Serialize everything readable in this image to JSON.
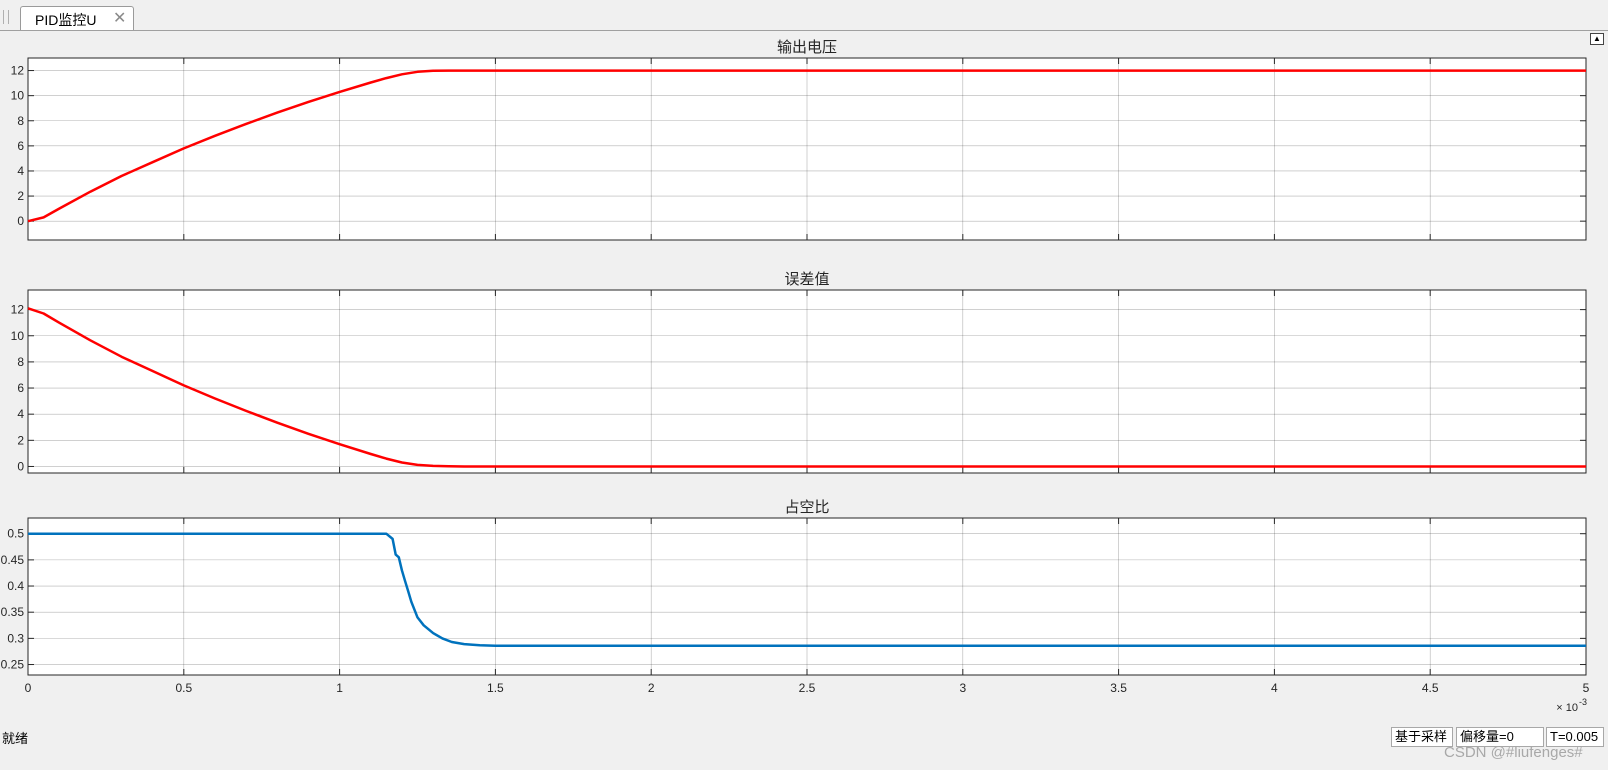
{
  "tab": {
    "label": "PID监控U",
    "close_glyph": "✕"
  },
  "status": {
    "ready": "就绪",
    "sampling": "基于采样",
    "offset": "偏移量=0",
    "time": "T=0.005"
  },
  "watermark": "CSDN @#liufenges#",
  "chart_data": [
    {
      "type": "line",
      "title": "输出电压",
      "xlim": [
        0,
        5
      ],
      "ylim": [
        -1.5,
        13
      ],
      "yticks": [
        "0",
        "2",
        "4",
        "6",
        "8",
        "10",
        "12"
      ],
      "yticks_values": [
        0,
        2,
        4,
        6,
        8,
        10,
        12
      ],
      "grid": true,
      "series": [
        {
          "color": "#ff0000",
          "x": [
            0,
            0.05,
            0.1,
            0.2,
            0.3,
            0.4,
            0.5,
            0.6,
            0.7,
            0.8,
            0.9,
            1.0,
            1.1,
            1.15,
            1.2,
            1.25,
            1.3,
            1.35,
            1.4,
            1.5,
            2,
            2.5,
            3,
            3.5,
            4,
            4.5,
            5
          ],
          "y": [
            0,
            0.3,
            1.0,
            2.35,
            3.6,
            4.7,
            5.8,
            6.8,
            7.75,
            8.65,
            9.5,
            10.3,
            11.05,
            11.4,
            11.7,
            11.9,
            11.98,
            12.0,
            12.0,
            12.0,
            12.0,
            12.0,
            12.0,
            12.0,
            12.0,
            12.0,
            12.0
          ]
        }
      ]
    },
    {
      "type": "line",
      "title": "误差值",
      "xlim": [
        0,
        5
      ],
      "ylim": [
        -0.5,
        13.5
      ],
      "yticks": [
        "0",
        "2",
        "4",
        "6",
        "8",
        "10",
        "12"
      ],
      "yticks_values": [
        0,
        2,
        4,
        6,
        8,
        10,
        12
      ],
      "grid": true,
      "series": [
        {
          "color": "#ff0000",
          "x": [
            0,
            0.05,
            0.1,
            0.2,
            0.3,
            0.4,
            0.5,
            0.6,
            0.7,
            0.8,
            0.9,
            1.0,
            1.1,
            1.15,
            1.2,
            1.25,
            1.3,
            1.35,
            1.4,
            1.5,
            2,
            2.5,
            3,
            3.5,
            4,
            4.5,
            5
          ],
          "y": [
            12.1,
            11.7,
            11.0,
            9.65,
            8.4,
            7.3,
            6.2,
            5.2,
            4.25,
            3.35,
            2.5,
            1.7,
            0.95,
            0.6,
            0.3,
            0.12,
            0.04,
            0.01,
            0.0,
            0.0,
            0.0,
            0.0,
            0.0,
            0.0,
            0.0,
            0.0,
            0.0
          ]
        }
      ]
    },
    {
      "type": "line",
      "title": "占空比",
      "xlim": [
        0,
        5
      ],
      "ylim": [
        0.23,
        0.53
      ],
      "yticks": [
        "0.25",
        "0.3",
        "0.35",
        "0.4",
        "0.45",
        "0.5"
      ],
      "yticks_values": [
        0.25,
        0.3,
        0.35,
        0.4,
        0.45,
        0.5
      ],
      "xticks": [
        "0",
        "0.5",
        "1",
        "1.5",
        "2",
        "2.5",
        "3",
        "3.5",
        "4",
        "4.5",
        "5"
      ],
      "xticks_values": [
        0,
        0.5,
        1,
        1.5,
        2,
        2.5,
        3,
        3.5,
        4,
        4.5,
        5
      ],
      "x_exponent_base": "× 10",
      "x_exponent": "-3",
      "grid": true,
      "series": [
        {
          "color": "#0072bd",
          "x": [
            0,
            1.15,
            1.17,
            1.18,
            1.19,
            1.2,
            1.21,
            1.22,
            1.23,
            1.24,
            1.25,
            1.27,
            1.3,
            1.33,
            1.36,
            1.4,
            1.45,
            1.5,
            2,
            2.5,
            3,
            3.5,
            4,
            4.5,
            5
          ],
          "y": [
            0.5,
            0.5,
            0.49,
            0.46,
            0.455,
            0.43,
            0.41,
            0.39,
            0.37,
            0.355,
            0.34,
            0.325,
            0.31,
            0.3,
            0.293,
            0.289,
            0.287,
            0.286,
            0.286,
            0.286,
            0.286,
            0.286,
            0.286,
            0.286,
            0.286
          ]
        }
      ]
    }
  ]
}
